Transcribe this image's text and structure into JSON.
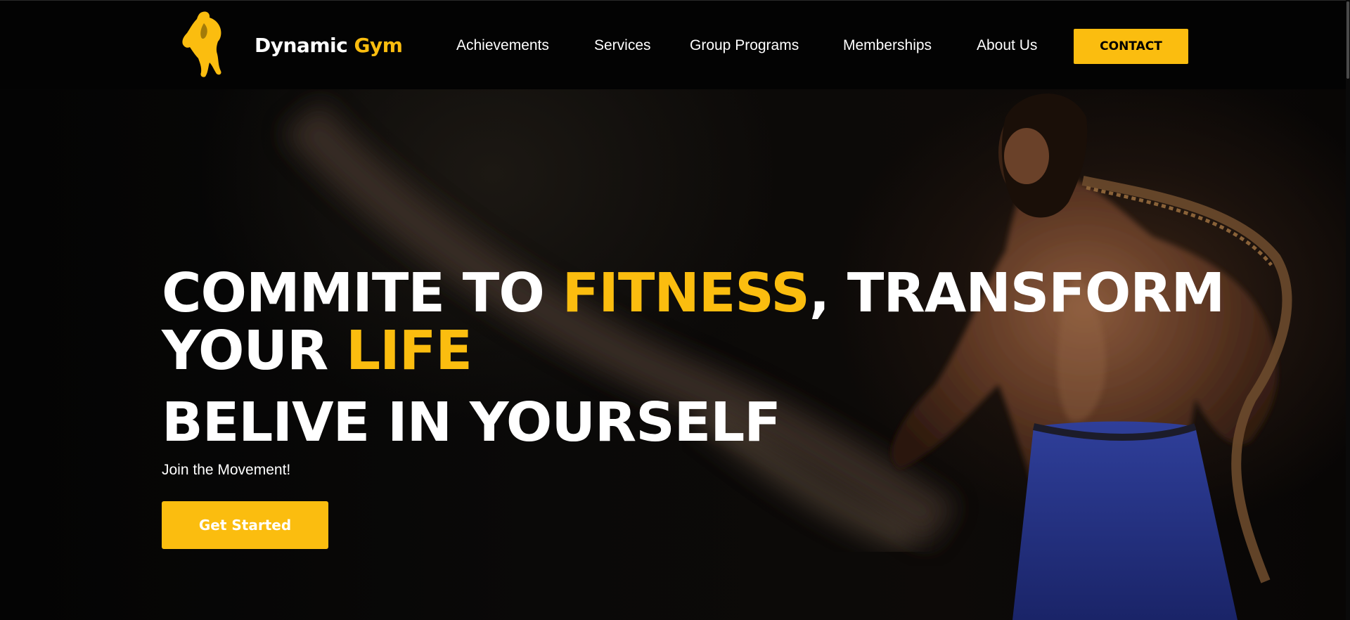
{
  "brand": {
    "name_part1": "Dynamic",
    "name_part2": "Gym",
    "logo_icon": "bodybuilder-logo-icon",
    "accent_color": "#fbbd0f"
  },
  "nav": {
    "items": [
      {
        "label": "Achievements"
      },
      {
        "label": "Services"
      },
      {
        "label": "Group Programs"
      },
      {
        "label": "Memberships"
      },
      {
        "label": "About Us"
      }
    ],
    "contact_label": "CONTACT"
  },
  "hero": {
    "headline_part1": "COMMITE TO ",
    "headline_accent1": "FITNESS",
    "headline_part2": ", TRANSFORM",
    "headline_part3": "YOUR ",
    "headline_accent2": "LIFE",
    "subheadline": "BELIVE IN YOURSELF",
    "tagline": "Join the Movement!",
    "cta_label": "Get Started",
    "background": "gym-athlete-with-battle-rope-photo"
  }
}
